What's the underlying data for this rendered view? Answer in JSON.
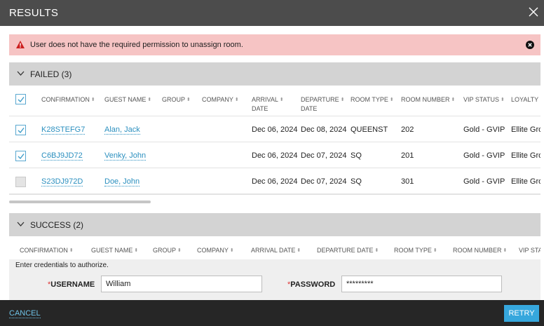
{
  "dialog": {
    "title": "RESULTS"
  },
  "error": {
    "message": "User does not have the required permission to unassign room."
  },
  "failed": {
    "label": "FAILED (3)",
    "select_all_checked": true,
    "columns": [
      "CONFIRMATION",
      "GUEST NAME",
      "GROUP",
      "COMPANY",
      "ARRIVAL",
      "DATE",
      "DEPARTURE",
      "DATE",
      "ROOM TYPE",
      "ROOM NUMBER",
      "VIP STATUS",
      "LOYALTY"
    ],
    "rows": [
      {
        "checked": true,
        "confirmation": "K28STEFG7",
        "guest": "Alan, Jack",
        "group": "",
        "company": "",
        "arrival": "Dec 06, 2024",
        "departure": "Dec 08, 2024",
        "room_type": "QUEENST",
        "room_number": "202",
        "vip": "Gold - GVIP",
        "loyalty": "Ellite Gro"
      },
      {
        "checked": true,
        "confirmation": "C6BJ9JD72",
        "guest": "Venky, John",
        "group": "",
        "company": "",
        "arrival": "Dec 06, 2024",
        "departure": "Dec 07, 2024",
        "room_type": "SQ",
        "room_number": "201",
        "vip": "Gold - GVIP",
        "loyalty": "Ellite Gro"
      },
      {
        "checked": false,
        "confirmation": "S23DJ972D",
        "guest": "Doe, John",
        "group": "",
        "company": "",
        "arrival": "Dec 06, 2024",
        "departure": "Dec 07, 2024",
        "room_type": "SQ",
        "room_number": "301",
        "vip": "Gold - GVIP",
        "loyalty": "Ellite Gro"
      }
    ]
  },
  "success": {
    "label": "SUCCESS (2)",
    "columns": [
      "CONFIRMATION",
      "GUEST NAME",
      "GROUP",
      "COMPANY",
      "ARRIVAL DATE",
      "DEPARTURE DATE",
      "ROOM TYPE",
      "ROOM NUMBER",
      "VIP STA"
    ]
  },
  "auth": {
    "prompt": "Enter credentials to authorize.",
    "username_label": "USERNAME",
    "username_value": "William",
    "password_label": "PASSWORD",
    "password_value": "*********",
    "required_mark": "*"
  },
  "footer": {
    "cancel_label": "CANCEL",
    "retry_label": "RETRY"
  },
  "colors": {
    "accent": "#36a7dd",
    "error_bg": "#f6c4c4",
    "error_icon": "#cc1f1f",
    "link": "#2a8fbf"
  }
}
